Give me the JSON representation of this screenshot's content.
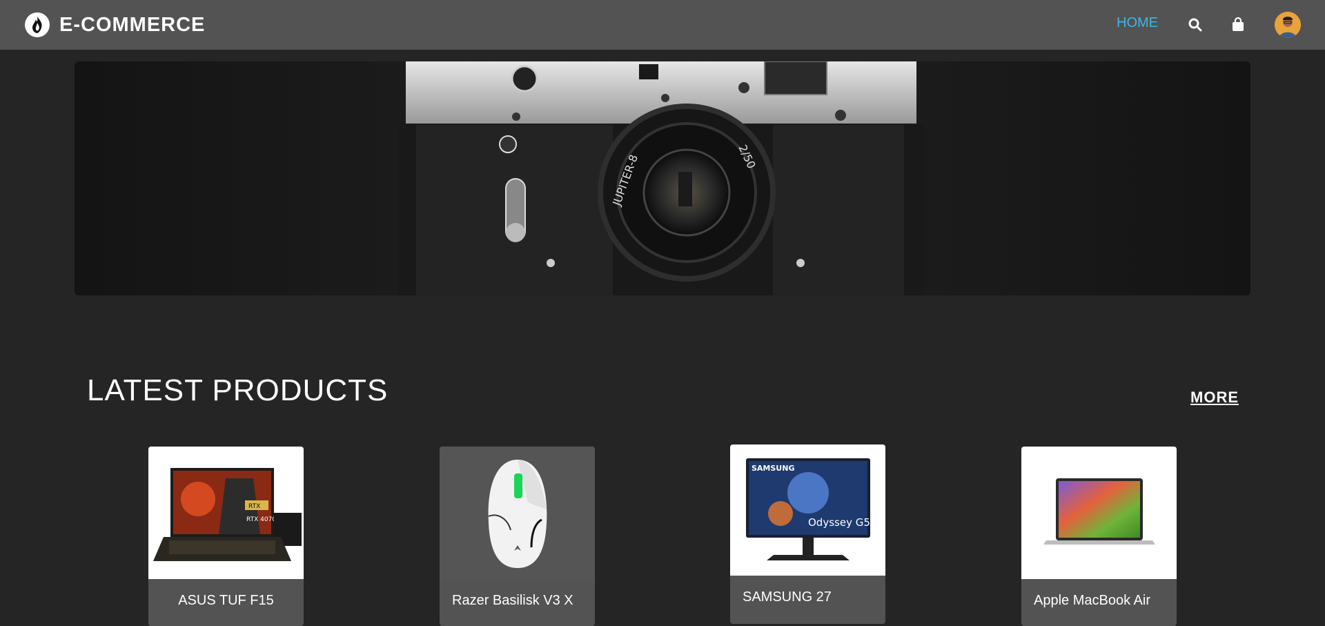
{
  "header": {
    "brand": "E-COMMERCE",
    "nav": {
      "home": "HOME"
    },
    "icons": [
      "flame-logo-icon",
      "search-icon",
      "shopping-bag-icon",
      "avatar"
    ]
  },
  "hero": {
    "lens_text_left": "JUPITER-8",
    "lens_text_right": "2/50"
  },
  "section": {
    "title": "LATEST PRODUCTS",
    "more": "MORE"
  },
  "products": [
    {
      "name": "ASUS TUF F15"
    },
    {
      "name": "Razer Basilisk V3 X"
    },
    {
      "name": "SAMSUNG 27"
    },
    {
      "name": "Apple MacBook Air"
    }
  ],
  "product_image_text": {
    "monitor_brand": "SAMSUNG",
    "monitor_model": "Odyssey G5",
    "laptop_badge_1": "RTX",
    "laptop_badge_2": "RTX 4070"
  },
  "colors": {
    "header_bg": "#535353",
    "page_bg": "#252525",
    "accent": "#3fb6e6",
    "card_bg": "#535353"
  }
}
